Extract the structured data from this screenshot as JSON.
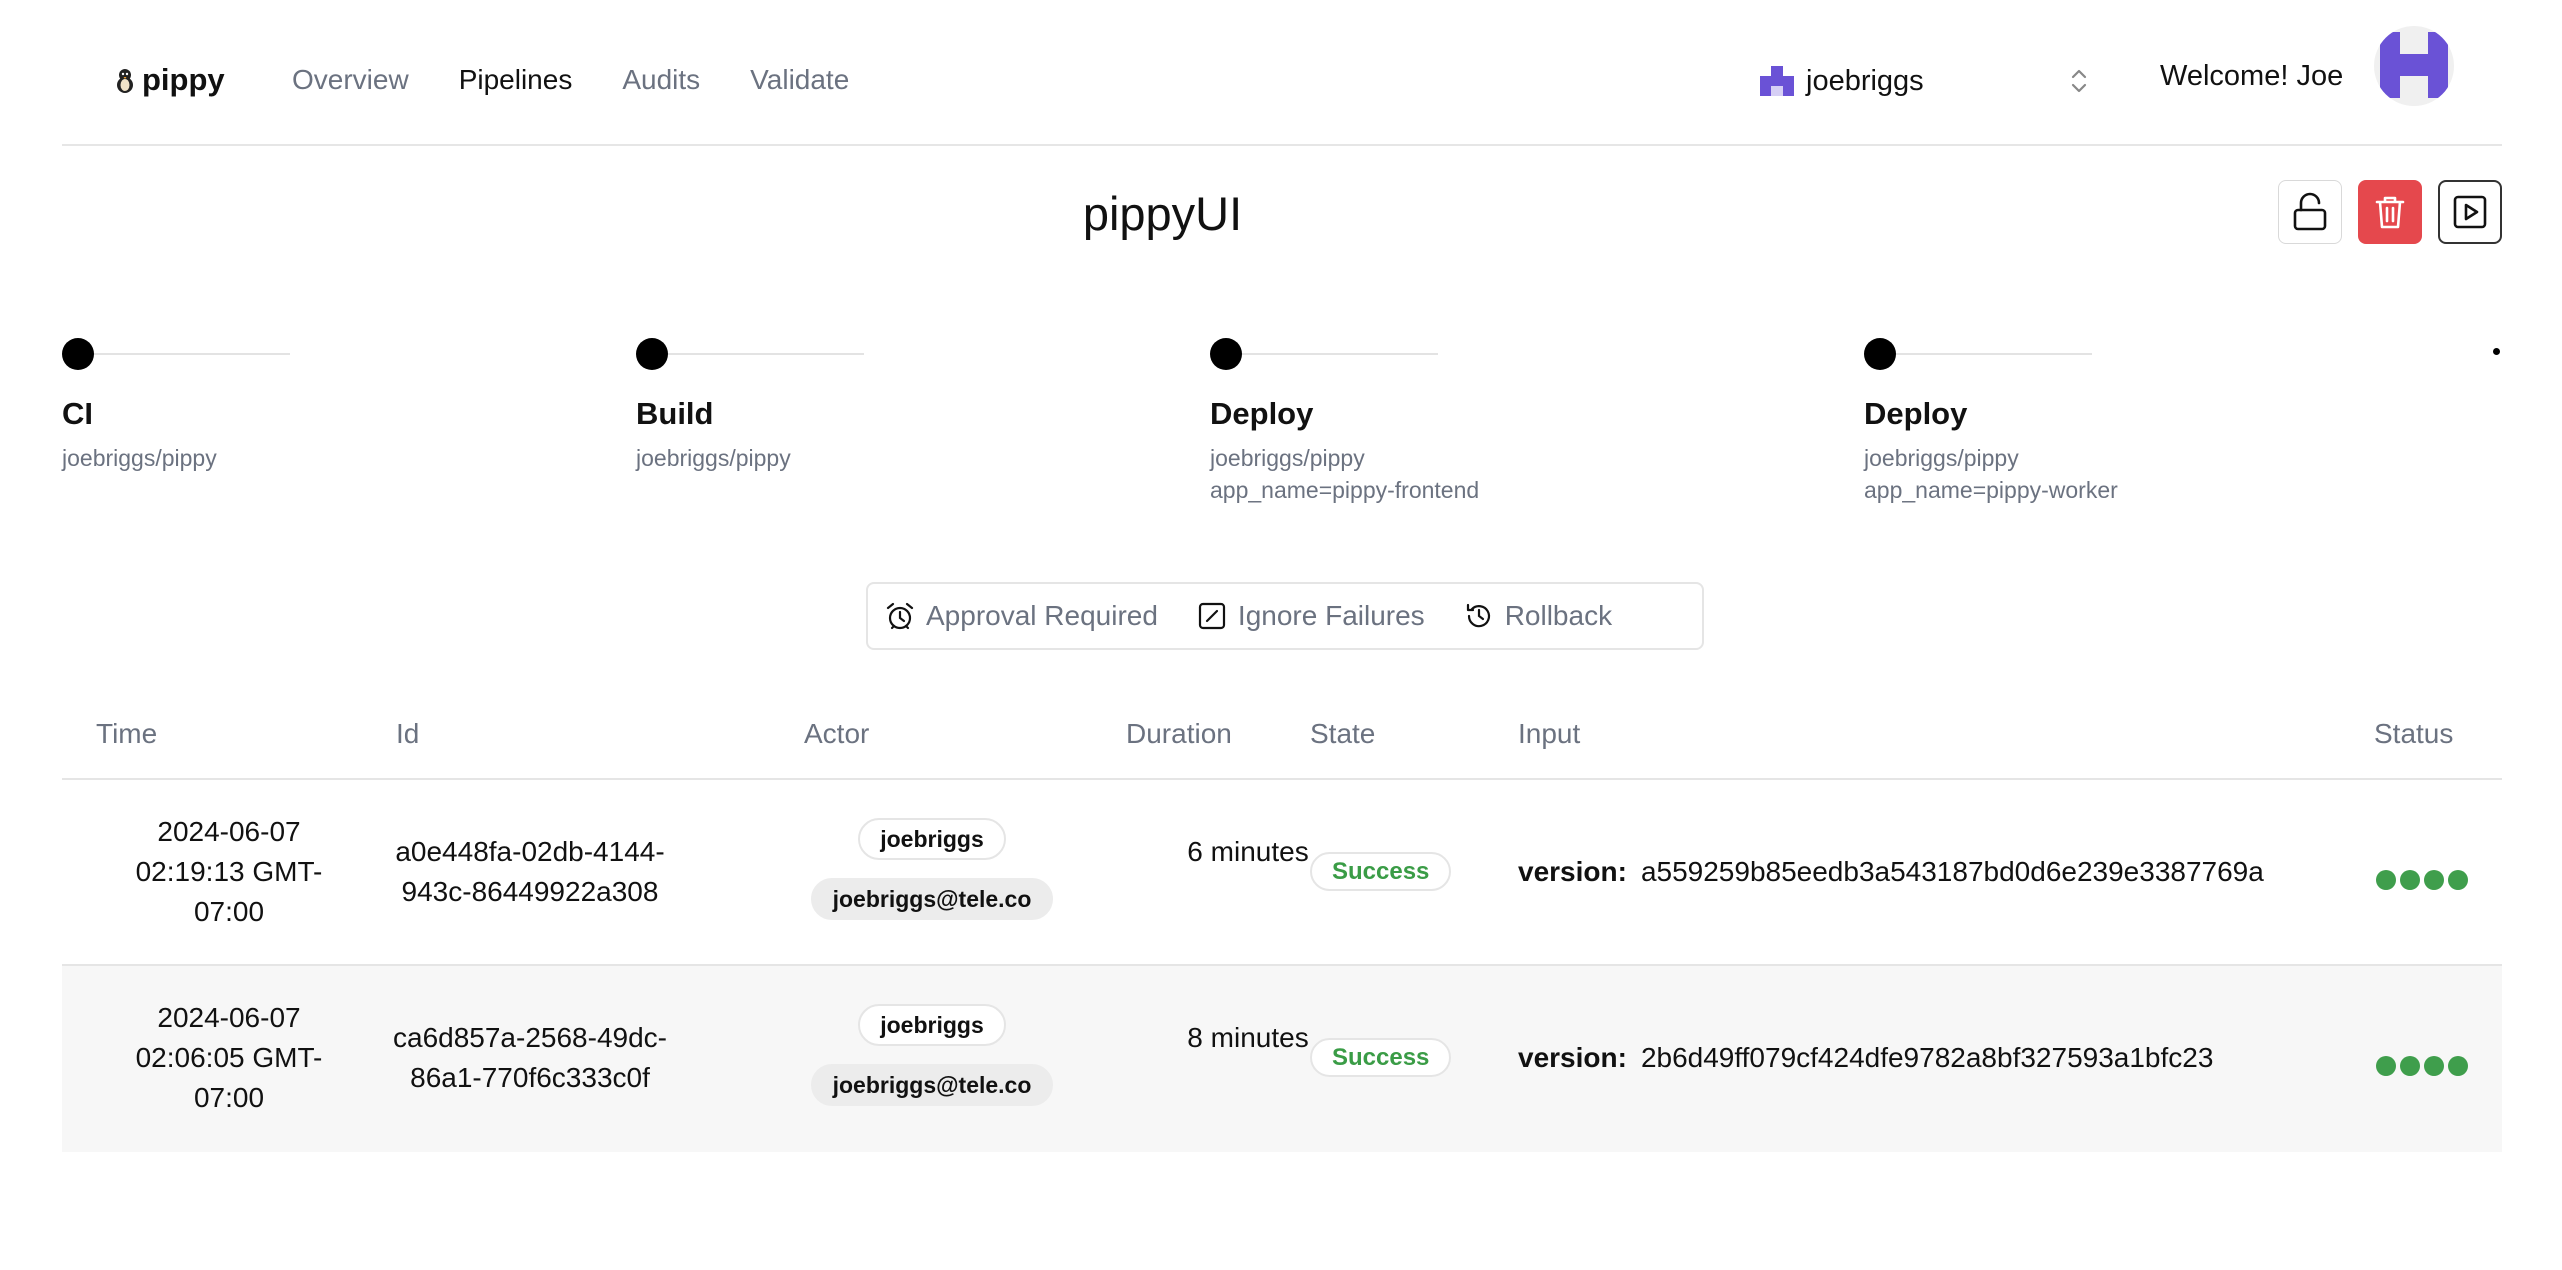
{
  "app": {
    "name": "pippy"
  },
  "nav": {
    "items": [
      {
        "label": "Overview",
        "active": false
      },
      {
        "label": "Pipelines",
        "active": true
      },
      {
        "label": "Audits",
        "active": false
      },
      {
        "label": "Validate",
        "active": false
      }
    ]
  },
  "org": {
    "name": "joebriggs"
  },
  "user": {
    "welcome": "Welcome! Joe"
  },
  "pipeline": {
    "title": "pippyUI"
  },
  "steps": [
    {
      "name": "CI",
      "lines": [
        "joebriggs/pippy"
      ]
    },
    {
      "name": "Build",
      "lines": [
        "joebriggs/pippy"
      ]
    },
    {
      "name": "Deploy",
      "lines": [
        "joebriggs/pippy",
        "app_name=pippy-frontend"
      ]
    },
    {
      "name": "Deploy",
      "lines": [
        "joebriggs/pippy",
        "app_name=pippy-worker"
      ]
    }
  ],
  "options": {
    "approval": "Approval Required",
    "ignore": "Ignore Failures",
    "rollback": "Rollback"
  },
  "table": {
    "headers": {
      "time": "Time",
      "id": "Id",
      "actor": "Actor",
      "duration": "Duration",
      "state": "State",
      "input": "Input",
      "status": "Status"
    },
    "rows": [
      {
        "time": "2024-06-07 02:19:13 GMT-07:00",
        "id": "a0e448fa-02db-4144-943c-86449922a308",
        "actor_name": "joebriggs",
        "actor_email": "joebriggs@tele.co",
        "duration": "6 minutes",
        "state": "Success",
        "input_key": "version:",
        "input_value": "a559259b85eedb3a543187bd0d6e239e3387769a"
      },
      {
        "time": "2024-06-07 02:06:05 GMT-07:00",
        "id": "ca6d857a-2568-49dc-86a1-770f6c333c0f",
        "actor_name": "joebriggs",
        "actor_email": "joebriggs@tele.co",
        "duration": "8 minutes",
        "state": "Success",
        "input_key": "version:",
        "input_value": "2b6d49ff079cf424dfe9782a8bf327593a1bfc23"
      }
    ]
  },
  "colors": {
    "accent": "#6a52d6",
    "danger": "#e5484d",
    "success": "#3f9e4c"
  }
}
